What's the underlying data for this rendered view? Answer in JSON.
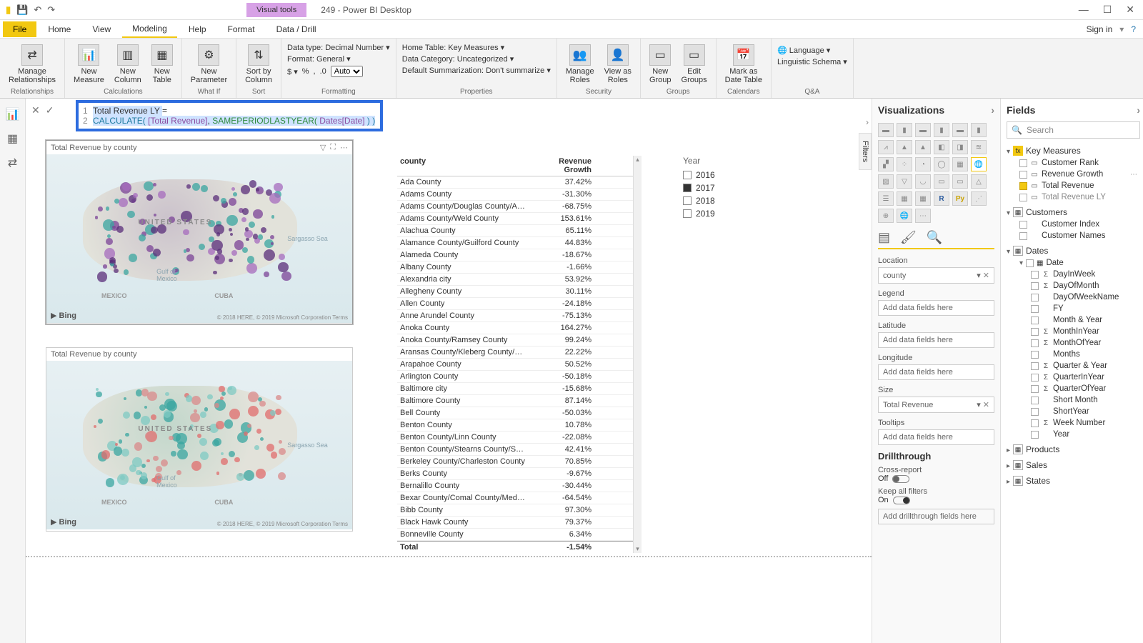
{
  "titlebar": {
    "visual_tools": "Visual tools",
    "title": "249 - Power BI Desktop"
  },
  "menu": {
    "file": "File",
    "home": "Home",
    "view": "View",
    "modeling": "Modeling",
    "help": "Help",
    "format": "Format",
    "datadrill": "Data / Drill",
    "signin": "Sign in"
  },
  "ribbon": {
    "manage_rel": "Manage\nRelationships",
    "rel_group": "Relationships",
    "new_measure": "New\nMeasure",
    "new_column": "New\nColumn",
    "new_table": "New\nTable",
    "new_param": "New\nParameter",
    "sort_by": "Sort by\nColumn",
    "calc_group": "Calculations",
    "whatif_group": "What If",
    "sort_group": "Sort",
    "datatype": "Data type: Decimal Number ▾",
    "format": "Format: General ▾",
    "auto": "Auto",
    "format_group": "Formatting",
    "hometable": "Home Table: Key Measures ▾",
    "datacat": "Data Category: Uncategorized ▾",
    "defsum": "Default Summarization: Don't summarize ▾",
    "prop_group": "Properties",
    "manage_roles": "Manage\nRoles",
    "view_as": "View as\nRoles",
    "sec_group": "Security",
    "new_group": "New\nGroup",
    "edit_groups": "Edit\nGroups",
    "groups_group": "Groups",
    "mark_date": "Mark as\nDate Table",
    "cal_group": "Calendars",
    "language": "Language ▾",
    "ling": "Linguistic Schema ▾",
    "qa_group": "Q&A"
  },
  "formula": {
    "line1_pre": "Total Revenue LY ",
    "eq": "=",
    "calc": "CALCULATE(",
    "fld1": " [Total Revenue]",
    "comma": ", ",
    "fn": "SAMEPERIODLASTYEAR(",
    "fld2": " Dates[Date] ",
    "close": ") )"
  },
  "map1": {
    "title": "Total Revenue by county",
    "bing": "Bing",
    "us": "UNITED STATES",
    "sea": "Sargasso Sea",
    "gulf": "Gulf of\nMexico",
    "mex": "MEXICO",
    "cuba": "CUBA",
    "attrib": "© 2018 HERE, © 2019 Microsoft Corporation  Terms"
  },
  "map2": {
    "title": "Total Revenue by county",
    "bing": "Bing",
    "us": "UNITED STATES",
    "sea": "Sargasso Sea",
    "gulf": "Gulf of\nMexico",
    "mex": "MEXICO",
    "cuba": "CUBA",
    "attrib": "© 2018 HERE, © 2019 Microsoft Corporation  Terms"
  },
  "table": {
    "h1": "county",
    "h2": "Revenue Growth",
    "rows": [
      {
        "c": "Ada County",
        "v": "37.42%"
      },
      {
        "c": "Adams County",
        "v": "-31.30%"
      },
      {
        "c": "Adams County/Douglas County/A…",
        "v": "-68.75%"
      },
      {
        "c": "Adams County/Weld County",
        "v": "153.61%"
      },
      {
        "c": "Alachua County",
        "v": "65.11%"
      },
      {
        "c": "Alamance County/Guilford County",
        "v": "44.83%"
      },
      {
        "c": "Alameda County",
        "v": "-18.67%"
      },
      {
        "c": "Albany County",
        "v": "-1.66%"
      },
      {
        "c": "Alexandria city",
        "v": "53.92%"
      },
      {
        "c": "Allegheny County",
        "v": "30.11%"
      },
      {
        "c": "Allen County",
        "v": "-24.18%"
      },
      {
        "c": "Anne Arundel County",
        "v": "-75.13%"
      },
      {
        "c": "Anoka County",
        "v": "164.27%"
      },
      {
        "c": "Anoka County/Ramsey County",
        "v": "99.24%"
      },
      {
        "c": "Aransas County/Kleberg County/…",
        "v": "22.22%"
      },
      {
        "c": "Arapahoe County",
        "v": "50.52%"
      },
      {
        "c": "Arlington County",
        "v": "-50.18%"
      },
      {
        "c": "Baltimore city",
        "v": "-15.68%"
      },
      {
        "c": "Baltimore County",
        "v": "87.14%"
      },
      {
        "c": "Bell County",
        "v": "-50.03%"
      },
      {
        "c": "Benton County",
        "v": "10.78%"
      },
      {
        "c": "Benton County/Linn County",
        "v": "-22.08%"
      },
      {
        "c": "Benton County/Stearns County/S…",
        "v": "42.41%"
      },
      {
        "c": "Berkeley County/Charleston County",
        "v": "70.85%"
      },
      {
        "c": "Berks County",
        "v": "-9.67%"
      },
      {
        "c": "Bernalillo County",
        "v": "-30.44%"
      },
      {
        "c": "Bexar County/Comal County/Med…",
        "v": "-64.54%"
      },
      {
        "c": "Bibb County",
        "v": "97.30%"
      },
      {
        "c": "Black Hawk County",
        "v": "79.37%"
      },
      {
        "c": "Bonneville County",
        "v": "6.34%"
      }
    ],
    "total_l": "Total",
    "total_v": "-1.54%"
  },
  "slicer": {
    "header": "Year",
    "opts": [
      {
        "l": "2016",
        "checked": false
      },
      {
        "l": "2017",
        "checked": true
      },
      {
        "l": "2018",
        "checked": false
      },
      {
        "l": "2019",
        "checked": false
      }
    ]
  },
  "filters_label": "Filters",
  "viz": {
    "header": "Visualizations",
    "wells": {
      "location": "Location",
      "location_v": "county",
      "legend": "Legend",
      "legend_v": "Add data fields here",
      "latitude": "Latitude",
      "latitude_v": "Add data fields here",
      "longitude": "Longitude",
      "longitude_v": "Add data fields here",
      "size": "Size",
      "size_v": "Total Revenue",
      "tooltips": "Tooltips",
      "tooltips_v": "Add data fields here"
    },
    "drill": "Drillthrough",
    "cross": "Cross-report",
    "off": "Off",
    "keep": "Keep all filters",
    "on": "On",
    "adddrill": "Add drillthrough fields here"
  },
  "fields": {
    "header": "Fields",
    "search": "Search",
    "key": "Key Measures",
    "km": [
      {
        "n": "Customer Rank",
        "chk": false,
        "calc": true
      },
      {
        "n": "Revenue Growth",
        "chk": false,
        "calc": true,
        "more": true
      },
      {
        "n": "Total Revenue",
        "chk": true,
        "calc": true
      },
      {
        "n": "Total Revenue LY",
        "chk": false,
        "calc": true,
        "sel": true
      }
    ],
    "customers": "Customers",
    "cu": [
      {
        "n": "Customer Index"
      },
      {
        "n": "Customer Names"
      }
    ],
    "dates": "Dates",
    "date_h": "Date",
    "dt": [
      {
        "n": "DayInWeek",
        "sig": "Σ"
      },
      {
        "n": "DayOfMonth",
        "sig": "Σ"
      },
      {
        "n": "DayOfWeekName"
      },
      {
        "n": "FY"
      },
      {
        "n": "Month & Year"
      },
      {
        "n": "MonthInYear",
        "sig": "Σ"
      },
      {
        "n": "MonthOfYear",
        "sig": "Σ"
      },
      {
        "n": "Months"
      },
      {
        "n": "Quarter & Year",
        "sig": "Σ"
      },
      {
        "n": "QuarterInYear",
        "sig": "Σ"
      },
      {
        "n": "QuarterOfYear",
        "sig": "Σ"
      },
      {
        "n": "Short Month"
      },
      {
        "n": "ShortYear"
      },
      {
        "n": "Week Number",
        "sig": "Σ"
      },
      {
        "n": "Year"
      }
    ],
    "products": "Products",
    "sales": "Sales",
    "states": "States"
  }
}
